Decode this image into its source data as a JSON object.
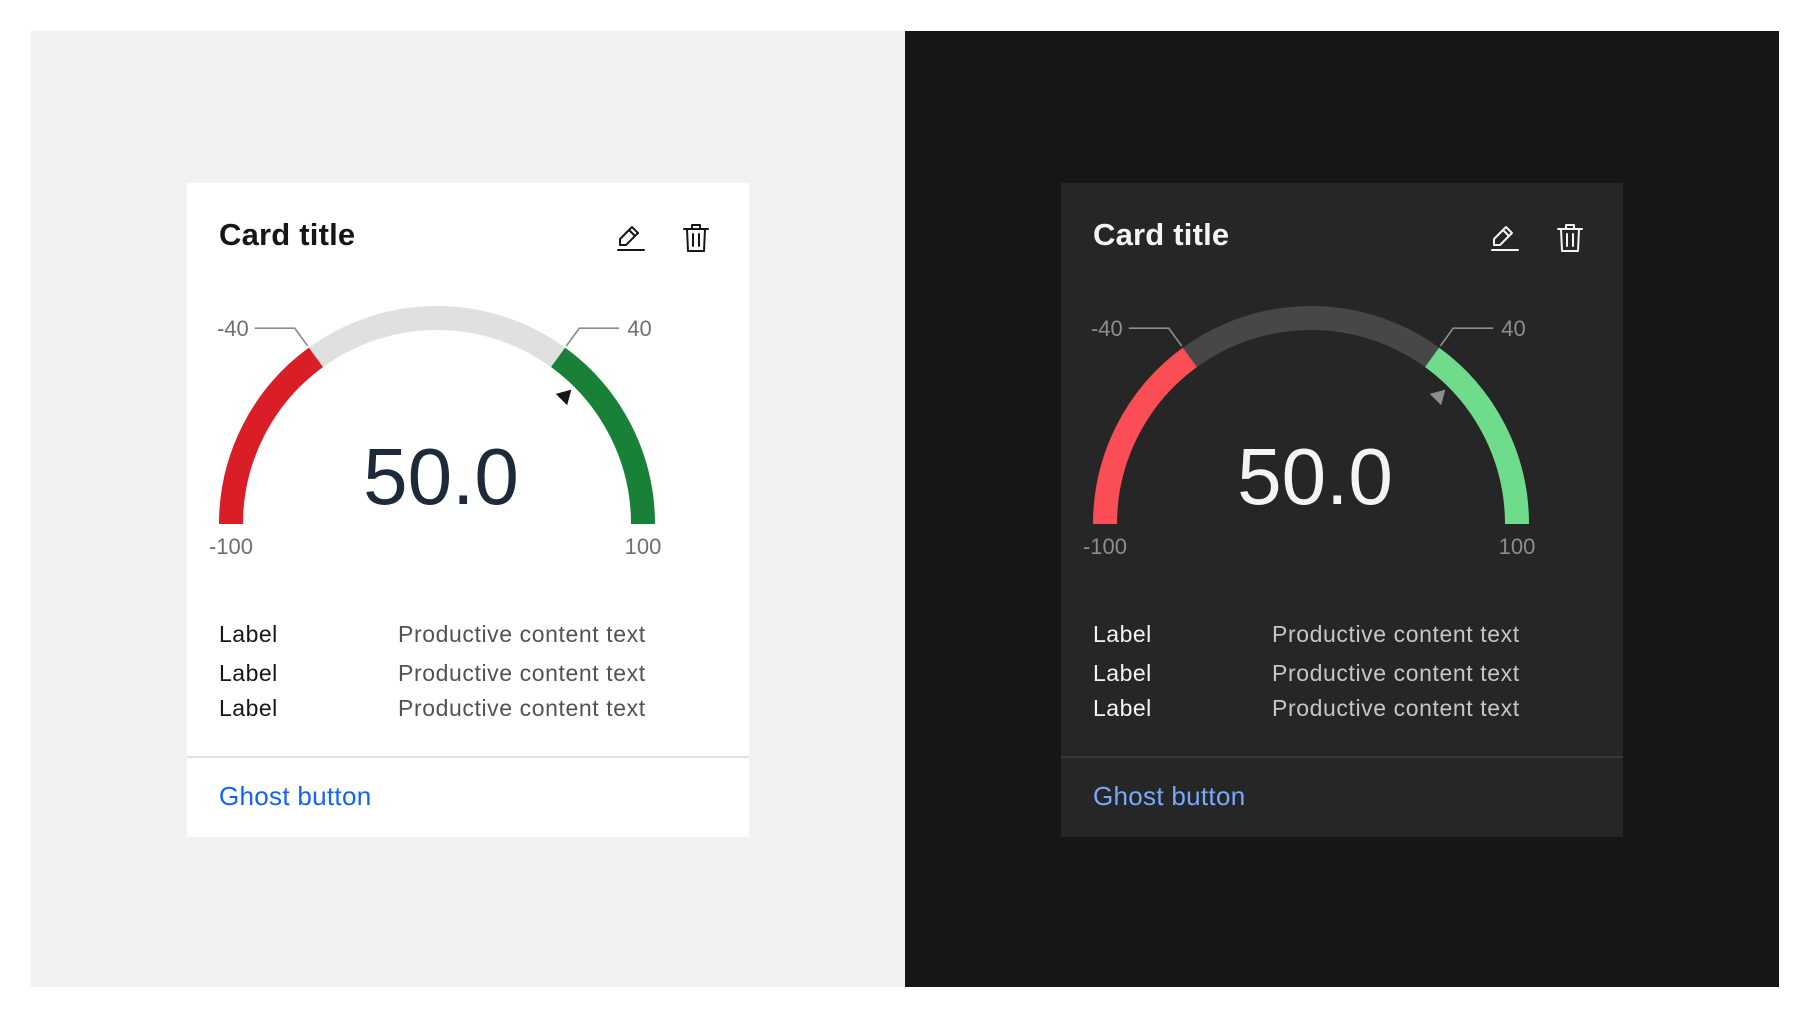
{
  "cards": [
    {
      "theme": "light",
      "title": "Card title",
      "edit_icon": "pencil-icon",
      "delete_icon": "trash-icon",
      "gauge": {
        "value": 50.0,
        "value_label": "50.0",
        "min": -100,
        "max": 100,
        "min_label": "-100",
        "max_label": "100",
        "low_threshold": -40,
        "high_threshold": 40,
        "low_threshold_label": "-40",
        "high_threshold_label": "40",
        "colors": {
          "low": "#da1e28",
          "mid": "#e0e0e0",
          "high": "#198038",
          "value_text": "#1d2a3a",
          "tick_text": "#6f6f6f",
          "leader": "#8d8d8d",
          "marker": "#161616"
        }
      },
      "rows": [
        {
          "label": "Label",
          "value": "Productive content text"
        },
        {
          "label": "Label",
          "value": "Productive content text"
        },
        {
          "label": "Label",
          "value": "Productive content text"
        }
      ],
      "ghost_button": "Ghost button"
    },
    {
      "theme": "dark",
      "title": "Card title",
      "edit_icon": "pencil-icon",
      "delete_icon": "trash-icon",
      "gauge": {
        "value": 50.0,
        "value_label": "50.0",
        "min": -100,
        "max": 100,
        "min_label": "-100",
        "max_label": "100",
        "low_threshold": -40,
        "high_threshold": 40,
        "low_threshold_label": "-40",
        "high_threshold_label": "40",
        "colors": {
          "low": "#fa4d56",
          "mid": "#474747",
          "high": "#6fdc8c",
          "value_text": "#f4f4f4",
          "tick_text": "#8d8d8d",
          "leader": "#8d8d8d",
          "marker": "#8d8d8d"
        }
      },
      "rows": [
        {
          "label": "Label",
          "value": "Productive content text"
        },
        {
          "label": "Label",
          "value": "Productive content text"
        },
        {
          "label": "Label",
          "value": "Productive content text"
        }
      ],
      "ghost_button": "Ghost button"
    }
  ]
}
